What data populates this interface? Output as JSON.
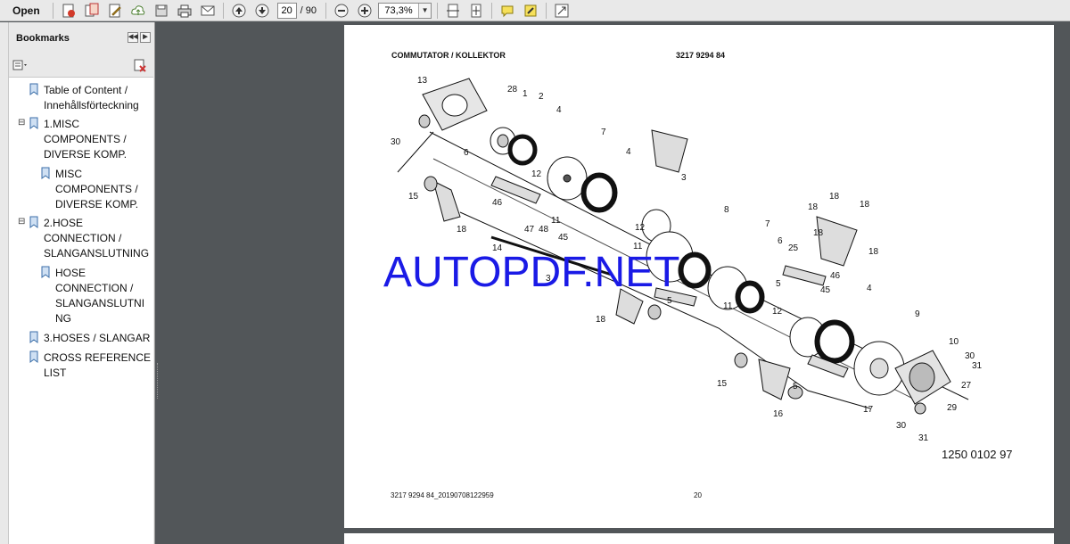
{
  "toolbar": {
    "open_label": "Open",
    "current_page": "20",
    "total_pages": "/ 90",
    "zoom": "73,3%"
  },
  "bookmarks": {
    "title": "Bookmarks",
    "items": [
      {
        "label": "Table of Content /\nInnehållsförteckning",
        "toggle": ""
      },
      {
        "label": "1.MISC\nCOMPONENTS /\nDIVERSE KOMP.",
        "toggle": "⊟"
      },
      {
        "label": "MISC\nCOMPONENTS /\nDIVERSE KOMP.",
        "toggle": ""
      },
      {
        "label": "2.HOSE\nCONNECTION /\nSLANGANSLUTNING",
        "toggle": "⊟"
      },
      {
        "label": "HOSE\nCONNECTION /\nSLANGANSLUTNI\nNG",
        "toggle": ""
      },
      {
        "label": "3.HOSES / SLANGAR",
        "toggle": ""
      },
      {
        "label": "CROSS REFERENCE\nLIST",
        "toggle": ""
      }
    ]
  },
  "document": {
    "title": "COMMUTATOR / KOLLEKTOR",
    "part_number": "3217 9294 84",
    "drawing_id": "1250 0102 97",
    "footer_file": "3217 9294 84_20190708122959",
    "footer_page": "20",
    "watermark": "AUTOPDF.NET",
    "callouts": [
      "13",
      "28",
      "1",
      "2",
      "4",
      "7",
      "4",
      "3",
      "30",
      "6",
      "12",
      "15",
      "46",
      "11",
      "18",
      "8",
      "12",
      "47",
      "48",
      "45",
      "11",
      "7",
      "18",
      "18",
      "18",
      "6",
      "25",
      "18",
      "18",
      "14",
      "3",
      "46",
      "45",
      "5",
      "11",
      "18",
      "5",
      "4",
      "12",
      "9",
      "10",
      "30",
      "31",
      "15",
      "27",
      "17",
      "29",
      "16",
      "5",
      "30",
      "31"
    ]
  }
}
